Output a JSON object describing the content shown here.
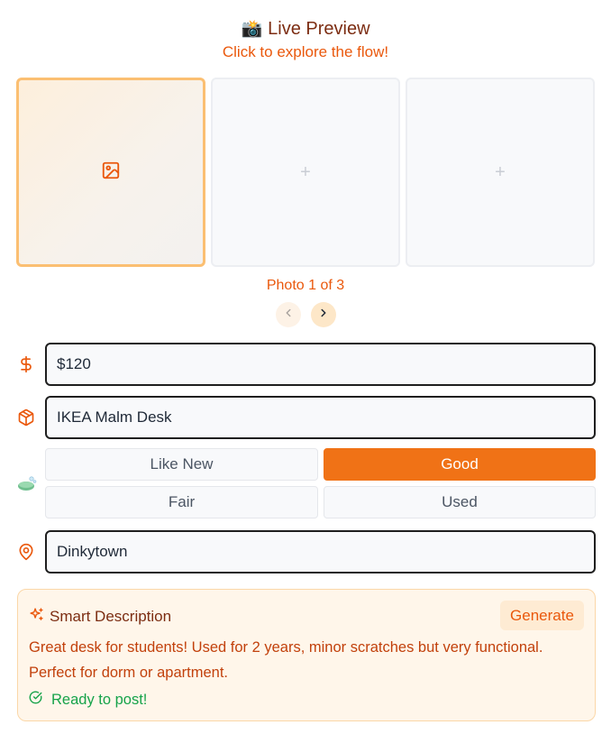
{
  "header": {
    "title": "Live Preview",
    "title_emoji": "📸",
    "subtitle": "Click to explore the flow!"
  },
  "photos": {
    "slots": [
      {
        "state": "active",
        "icon": "image-icon"
      },
      {
        "state": "empty",
        "icon": "plus-icon",
        "glyph": "+"
      },
      {
        "state": "empty",
        "icon": "plus-icon",
        "glyph": "+"
      }
    ],
    "counter": "Photo 1 of 3"
  },
  "form": {
    "price": {
      "icon": "dollar-icon",
      "value": "$120"
    },
    "title": {
      "icon": "package-icon",
      "value": "IKEA Malm Desk"
    },
    "condition": {
      "icon": "soap-icon",
      "options": [
        "Like New",
        "Good",
        "Fair",
        "Used"
      ],
      "selected": "Good"
    },
    "location": {
      "icon": "map-pin-icon",
      "value": "Dinkytown"
    }
  },
  "smart": {
    "heading": "Smart Description",
    "button": "Generate",
    "description": "Great desk for students! Used for 2 years, minor scratches but very functional. Perfect for dorm or apartment.",
    "status": "Ready to post!"
  },
  "colors": {
    "accent": "#f07216",
    "accent_text": "#ea580c",
    "success": "#16a34a",
    "heading": "#7c2d12"
  }
}
